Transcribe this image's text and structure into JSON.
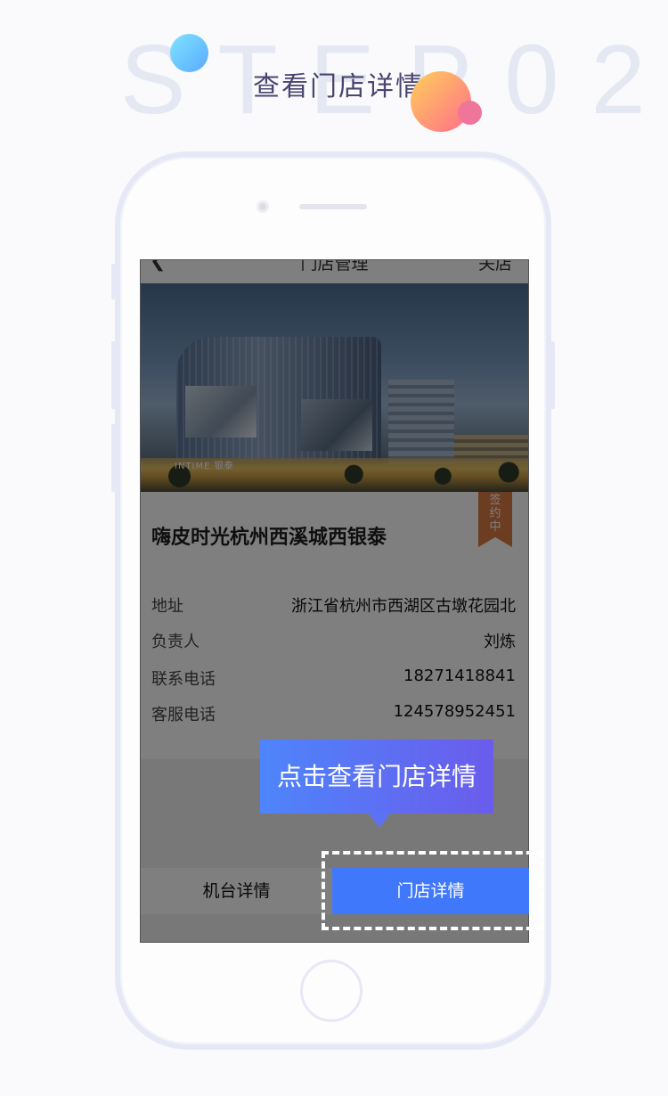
{
  "header": {
    "bg_step": "STEP02",
    "title": "查看门店详情"
  },
  "navbar": {
    "back_icon": "chevron-left",
    "title": "门店管理",
    "action": "关店"
  },
  "store": {
    "image_text": "INTIME 银泰",
    "name": "嗨皮时光杭州西溪城西银泰",
    "status_badge": "签约中",
    "fields": [
      {
        "label": "地址",
        "value": "浙江省杭州市西湖区古墩花园北"
      },
      {
        "label": "负责人",
        "value": "刘炼"
      },
      {
        "label": "联系电话",
        "value": "18271418841"
      },
      {
        "label": "客服电话",
        "value": "124578952451"
      }
    ]
  },
  "tabs": {
    "machine": "机台详情",
    "store": "门店详情"
  },
  "tooltip": "点击查看门店详情",
  "colors": {
    "accent": "#4078fb",
    "badge": "#d87a42",
    "tooltip_from": "#4e85fb",
    "tooltip_to": "#6a5cec"
  }
}
